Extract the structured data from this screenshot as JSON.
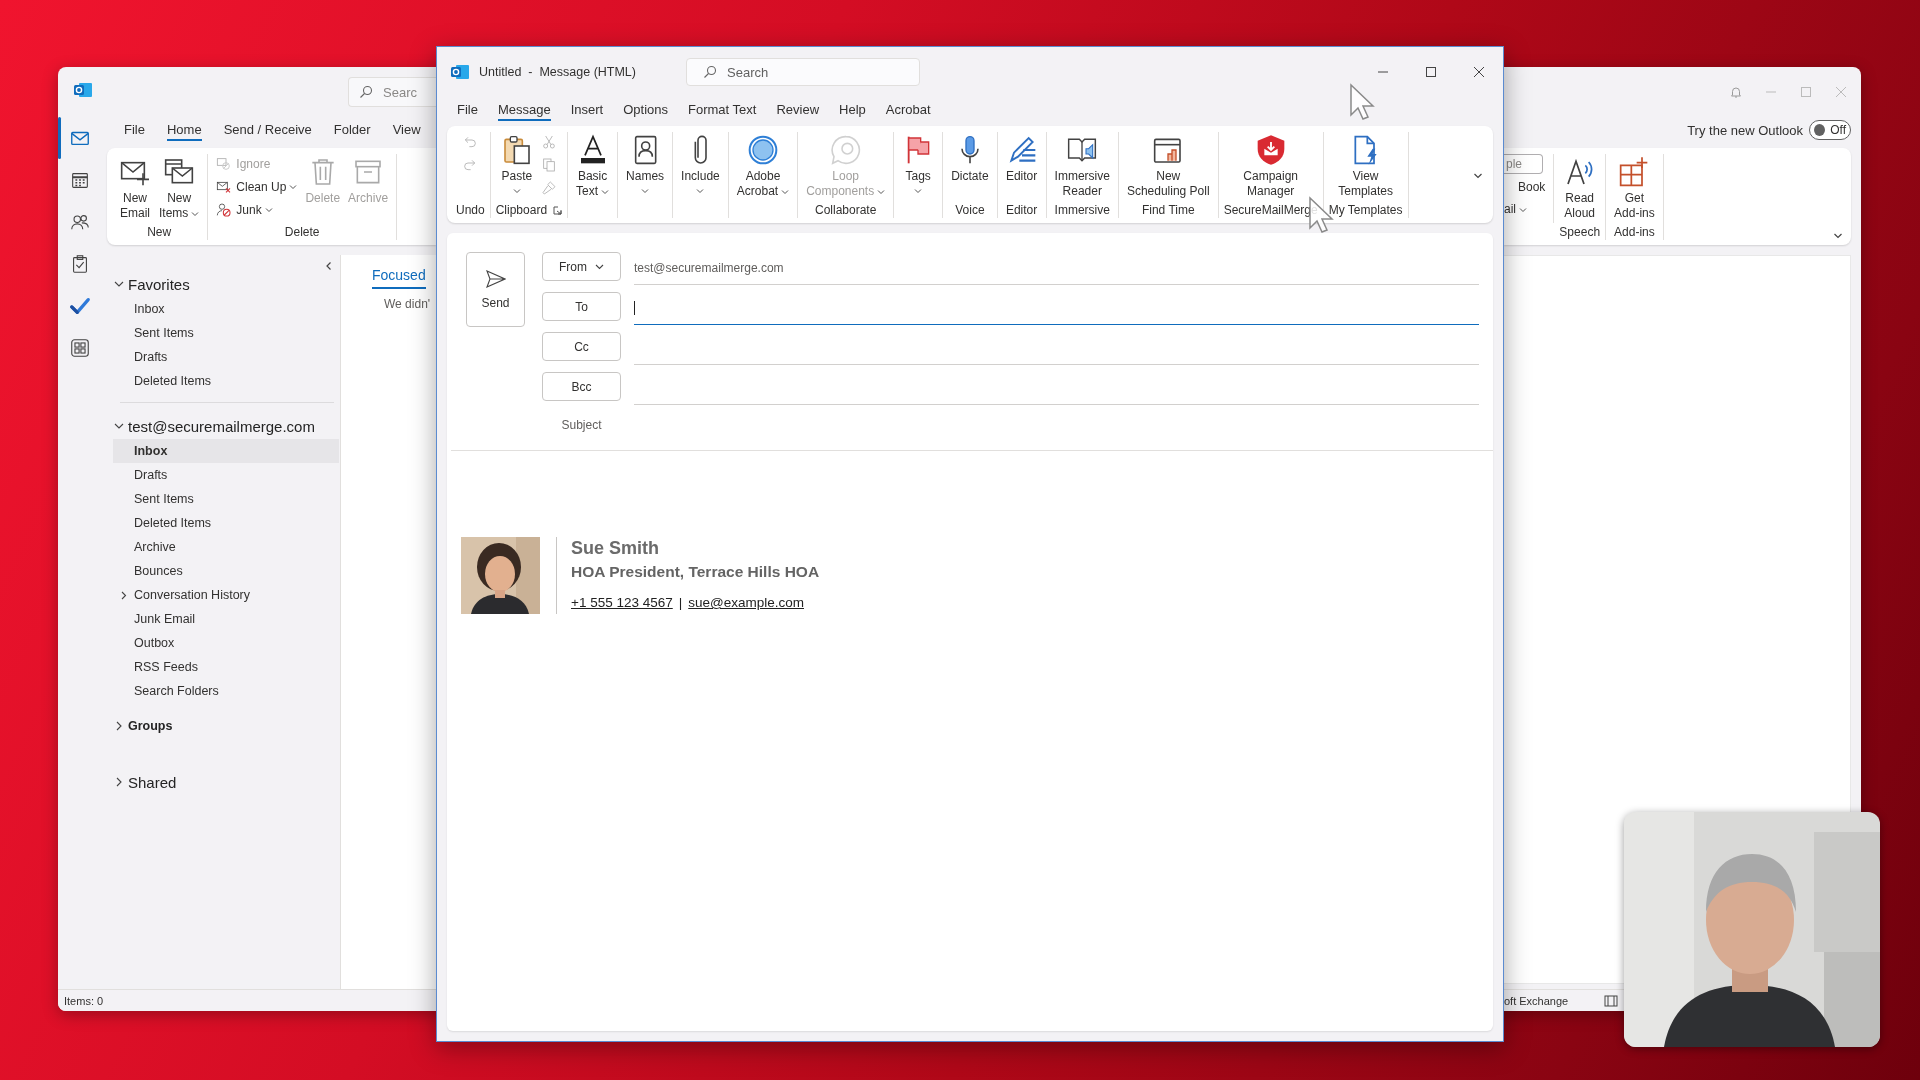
{
  "main_window": {
    "search": {
      "placeholder": "Searc"
    },
    "nav": [
      {
        "kind": "mail",
        "selected": true
      },
      {
        "kind": "calendar",
        "selected": false
      },
      {
        "kind": "people",
        "selected": false
      },
      {
        "kind": "tasks",
        "selected": false
      },
      {
        "kind": "todo",
        "selected": false
      },
      {
        "kind": "apps",
        "selected": false
      }
    ],
    "tabs": [
      {
        "label": "File",
        "selected": false
      },
      {
        "label": "Home",
        "selected": true
      },
      {
        "label": "Send / Receive",
        "selected": false
      },
      {
        "label": "Folder",
        "selected": false
      },
      {
        "label": "View",
        "selected": false
      }
    ],
    "ribbon": {
      "groups": [
        {
          "label": "New",
          "launcher": false,
          "buttons": [
            {
              "label": "New\nEmail",
              "kind": "new-email",
              "disabled": false,
              "dropdown": false
            },
            {
              "label": "New\nItems",
              "kind": "new-items",
              "disabled": false,
              "dropdown": true
            }
          ]
        },
        {
          "label": "Delete",
          "launcher": false,
          "buttons": [
            {
              "label": "Ignore",
              "kind": "ignore",
              "disabled": true,
              "dropdown": false
            },
            {
              "label": "Clean Up",
              "kind": "cleanup",
              "disabled": false,
              "dropdown": true
            },
            {
              "label": "Junk",
              "kind": "junk",
              "disabled": false,
              "dropdown": true
            },
            {
              "label": "Delete",
              "kind": "delete",
              "disabled": true,
              "dropdown": false
            },
            {
              "label": "Archive",
              "kind": "archive",
              "disabled": true,
              "dropdown": false
            }
          ]
        }
      ]
    },
    "folder_pane": {
      "sections": [
        {
          "label": "Favorites",
          "kind": "section",
          "expanded": true,
          "items": [
            {
              "label": "Inbox",
              "selected": false,
              "expandable": false
            },
            {
              "label": "Sent Items",
              "selected": false,
              "expandable": false
            },
            {
              "label": "Drafts",
              "selected": false,
              "expandable": false
            },
            {
              "label": "Deleted Items",
              "selected": false,
              "expandable": false
            }
          ]
        },
        {
          "label": "test@securemailmerge.com",
          "kind": "section",
          "expanded": true,
          "items": [
            {
              "label": "Inbox",
              "selected": true,
              "expandable": false
            },
            {
              "label": "Drafts",
              "selected": false,
              "expandable": false
            },
            {
              "label": "Sent Items",
              "selected": false,
              "expandable": false
            },
            {
              "label": "Deleted Items",
              "selected": false,
              "expandable": false
            },
            {
              "label": "Archive",
              "selected": false,
              "expandable": false
            },
            {
              "label": "Bounces",
              "selected": false,
              "expandable": false
            },
            {
              "label": "Conversation History",
              "selected": false,
              "expandable": true
            },
            {
              "label": "Junk Email",
              "selected": false,
              "expandable": false
            },
            {
              "label": "Outbox",
              "selected": false,
              "expandable": false
            },
            {
              "label": "RSS Feeds",
              "selected": false,
              "expandable": false
            },
            {
              "label": "Search Folders",
              "selected": false,
              "expandable": false
            }
          ]
        },
        {
          "label": "Groups",
          "kind": "subsection",
          "expanded": false
        },
        {
          "label": "Shared",
          "kind": "section",
          "expanded": false
        }
      ]
    },
    "message_list": {
      "tabs": [
        {
          "label": "Focused",
          "selected": true
        }
      ],
      "empty_text": "We didn'"
    },
    "new_outlook": {
      "label": "Try the new Outlook",
      "on": false,
      "state_text": "Off"
    },
    "right_ribbon": {
      "field": {
        "placeholder": "ple"
      },
      "buttons": [
        {
          "label": "Book",
          "dropdown": false
        },
        {
          "label": "ail",
          "dropdown": true
        }
      ],
      "groups": [
        {
          "label": "Speech",
          "launcher": false,
          "buttons": [
            {
              "label": "Read\nAloud",
              "kind": "read-aloud",
              "disabled": false,
              "dropdown": false
            }
          ]
        },
        {
          "label": "Add-ins",
          "launcher": false,
          "buttons": [
            {
              "label": "Get\nAdd-ins",
              "kind": "addins",
              "disabled": false,
              "dropdown": false
            }
          ]
        }
      ]
    },
    "status_bar": {
      "items": "Items: 0",
      "connection": "oft Exchange"
    }
  },
  "compose_window": {
    "title": "Untitled  -  Message (HTML)",
    "search": {
      "placeholder": "Search"
    },
    "tabs": [
      {
        "label": "File",
        "selected": false
      },
      {
        "label": "Message",
        "selected": true
      },
      {
        "label": "Insert",
        "selected": false
      },
      {
        "label": "Options",
        "selected": false
      },
      {
        "label": "Format Text",
        "selected": false
      },
      {
        "label": "Review",
        "selected": false
      },
      {
        "label": "Help",
        "selected": false
      },
      {
        "label": "Acrobat",
        "selected": false
      }
    ],
    "ribbon": {
      "groups": [
        {
          "label": "Undo",
          "launcher": false,
          "buttons": [
            {
              "kind": "undo",
              "disabled": true,
              "dropdown": false
            },
            {
              "kind": "redo",
              "disabled": true,
              "dropdown": false
            }
          ]
        },
        {
          "label": "Clipboard",
          "launcher": true,
          "buttons": [
            {
              "label": "Paste",
              "kind": "paste",
              "disabled": false,
              "dropdown": true
            },
            {
              "kind": "cut",
              "disabled": true,
              "dropdown": false
            },
            {
              "kind": "copy",
              "disabled": true,
              "dropdown": false
            },
            {
              "kind": "painter",
              "disabled": true,
              "dropdown": false
            }
          ]
        },
        {
          "buttons": [
            {
              "label": "Basic\nText",
              "kind": "basic-text",
              "disabled": false,
              "dropdown": true
            }
          ]
        },
        {
          "buttons": [
            {
              "label": "Names",
              "kind": "names",
              "disabled": false,
              "dropdown": true
            }
          ]
        },
        {
          "buttons": [
            {
              "label": "Include",
              "kind": "include",
              "disabled": false,
              "dropdown": true
            }
          ]
        },
        {
          "buttons": [
            {
              "label": "Adobe\nAcrobat",
              "kind": "acrobat",
              "disabled": false,
              "dropdown": true
            }
          ]
        },
        {
          "label": "Collaborate",
          "launcher": false,
          "buttons": [
            {
              "label": "Loop\nComponents",
              "kind": "loop",
              "disabled": true,
              "dropdown": true
            }
          ]
        },
        {
          "buttons": [
            {
              "label": "Tags",
              "kind": "tags",
              "disabled": false,
              "dropdown": true
            }
          ]
        },
        {
          "label": "Voice",
          "launcher": false,
          "buttons": [
            {
              "label": "Dictate",
              "kind": "dictate",
              "disabled": false,
              "dropdown": false
            }
          ]
        },
        {
          "label": "Editor",
          "launcher": false,
          "buttons": [
            {
              "label": "Editor",
              "kind": "editor",
              "disabled": false,
              "dropdown": false
            }
          ]
        },
        {
          "label": "Immersive",
          "launcher": false,
          "buttons": [
            {
              "label": "Immersive\nReader",
              "kind": "immersive",
              "disabled": false,
              "dropdown": false
            }
          ]
        },
        {
          "label": "Find Time",
          "launcher": false,
          "buttons": [
            {
              "label": "New\nScheduling Poll",
              "kind": "poll",
              "disabled": false,
              "dropdown": false
            }
          ]
        },
        {
          "label": "SecureMailMerge",
          "launcher": false,
          "buttons": [
            {
              "label": "Campaign\nManager",
              "kind": "campaign",
              "disabled": false,
              "dropdown": false
            }
          ]
        },
        {
          "label": "My Templates",
          "launcher": false,
          "buttons": [
            {
              "label": "View\nTemplates",
              "kind": "templates",
              "disabled": false,
              "dropdown": false
            }
          ]
        }
      ]
    },
    "send": "Send",
    "from": {
      "button": "From",
      "value": "test@securemailmerge.com"
    },
    "recipients": [
      {
        "button": "To",
        "focused": true
      },
      {
        "button": "Cc",
        "focused": false
      },
      {
        "button": "Bcc",
        "focused": false
      }
    ],
    "subject": {
      "label": "Subject"
    },
    "signature": {
      "name": "Sue Smith",
      "title": "HOA President, Terrace Hills HOA",
      "phone": "+1 555 123 4567",
      "separator": "|",
      "email": "sue@example.com"
    }
  }
}
